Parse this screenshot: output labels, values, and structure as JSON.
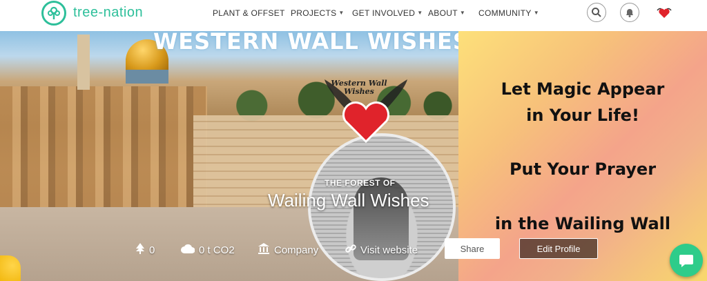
{
  "nav": {
    "brand": "tree-nation",
    "menu": [
      {
        "label": "PLANT & OFFSET",
        "has_dropdown": false
      },
      {
        "label": "PROJECTS",
        "has_dropdown": true
      },
      {
        "label": "GET INVOLVED",
        "has_dropdown": true
      },
      {
        "label": "ABOUT",
        "has_dropdown": true
      },
      {
        "label": "COMMUNITY",
        "has_dropdown": true
      }
    ],
    "icons": [
      "search-icon",
      "bell-icon",
      "user-avatar"
    ]
  },
  "hero": {
    "banner_title": "WESTERN WALL WISHES",
    "logo_text": "Western Wall Wishes",
    "right_text": [
      "Let Magic Appear",
      "in Your Life!",
      "Put Your Prayer",
      "in the Wailing Wall"
    ],
    "forest_subtitle": "THE FOREST OF",
    "forest_title": "Wailing Wall Wishes",
    "stats": {
      "trees": "0",
      "co2": "0 t CO2",
      "type": "Company",
      "website": "Visit website"
    },
    "buttons": {
      "share": "Share",
      "edit_profile": "Edit Profile"
    }
  },
  "colors": {
    "brand": "#2dbf9a",
    "chat": "#2ecc8a"
  }
}
